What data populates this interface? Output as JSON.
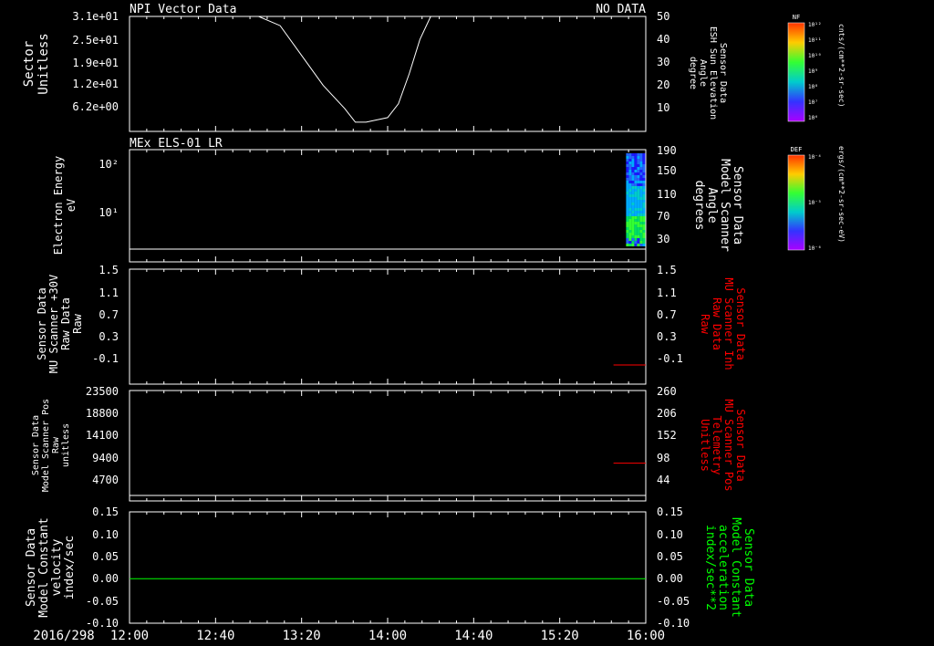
{
  "date_label": "2016/298",
  "time_ticks": [
    "12:00",
    "12:40",
    "13:20",
    "14:00",
    "14:40",
    "15:20",
    "16:00"
  ],
  "colors": {
    "white": "#ffffff",
    "red": "#ff0000",
    "green": "#00ff00"
  },
  "panels": [
    {
      "id": "npi",
      "title_left": "NPI Vector Data",
      "title_right": "NO DATA",
      "ylabel_left": [
        "Sector",
        "Unitless"
      ],
      "yticks_left": [
        "3.1e+01",
        "2.5e+01",
        "1.9e+01",
        "1.2e+01",
        "6.2e+00"
      ],
      "ylabel_right": [
        "Sensor Data",
        "ESH Sun Elevation",
        "Angle",
        "degree"
      ],
      "yticks_right": [
        "50",
        "40",
        "30",
        "20",
        "10"
      ],
      "colorbar": {
        "label": "NF",
        "units": "cnts/(cm**2-sr-sec)",
        "ticks": [
          "10¹²",
          "10¹¹",
          "10¹⁰",
          "10⁹",
          "10⁸",
          "10⁷",
          "10⁶"
        ]
      }
    },
    {
      "id": "els",
      "title_left": "MEx ELS-01 LR",
      "ylabel_left": [
        "Electron Energy",
        "eV"
      ],
      "yticks_left": [
        "10²",
        "10¹"
      ],
      "ylabel_right": [
        "Sensor Data",
        "Model Scanner",
        "Angle",
        "degrees"
      ],
      "yticks_right": [
        "190",
        "150",
        "110",
        "70",
        "30"
      ],
      "colorbar": {
        "label": "DEF",
        "units": "ergs/(cm**2-sr-sec-eV)",
        "ticks": [
          "10⁻⁴",
          "10⁻⁵",
          "10⁻⁶"
        ]
      }
    },
    {
      "id": "mu_raw",
      "ylabel_left": [
        "Sensor Data",
        "MU Scanner +30V",
        "Raw Data",
        "Raw"
      ],
      "yticks_left": [
        "1.5",
        "1.1",
        "0.7",
        "0.3",
        "-0.1"
      ],
      "ylabel_right": [
        "Sensor Data",
        "MU Scanner Inh",
        "Raw Data",
        "Raw"
      ],
      "yticks_right": [
        "1.5",
        "1.1",
        "0.7",
        "0.3",
        "-0.1"
      ]
    },
    {
      "id": "scanner_pos",
      "ylabel_left": [
        "Sensor Data",
        "Model Scanner Pos",
        "Raw",
        "unitless"
      ],
      "yticks_left": [
        "23500",
        "18800",
        "14100",
        "9400",
        "4700"
      ],
      "ylabel_right": [
        "Sensor Data",
        "MU Scanner Pos",
        "Telemetry",
        "Unitless"
      ],
      "yticks_right": [
        "260",
        "206",
        "152",
        "98",
        "44"
      ]
    },
    {
      "id": "velocity",
      "ylabel_left": [
        "Sensor Data",
        "Model Constant",
        "velocity",
        "index/sec"
      ],
      "yticks_left": [
        "0.15",
        "0.10",
        "0.05",
        "0.00",
        "-0.05",
        "-0.10"
      ],
      "ylabel_right": [
        "Sensor Data",
        "Model Constant",
        "acceleration",
        "index/sec**2"
      ],
      "yticks_right": [
        "0.15",
        "0.10",
        "0.05",
        "0.00",
        "-0.05",
        "-0.10"
      ]
    }
  ],
  "chart_data": [
    {
      "type": "line",
      "panel": "npi",
      "x_range": [
        "12:00",
        "16:00"
      ],
      "ylim": [
        0,
        50
      ],
      "x": [
        "12:00",
        "13:00",
        "13:10",
        "13:20",
        "13:30",
        "13:40",
        "13:45",
        "13:50",
        "13:55",
        "14:00",
        "14:05",
        "14:10",
        "14:15",
        "14:20",
        "16:00"
      ],
      "y": [
        50,
        50,
        46,
        33,
        20,
        10,
        4,
        4,
        5,
        6,
        12,
        25,
        40,
        50,
        50
      ]
    },
    {
      "type": "heatmap",
      "panel": "els",
      "x_range": [
        "15:50",
        "16:00"
      ],
      "y_range_energy_ev": [
        1.5,
        200
      ],
      "note_values": "spectrogram strip at end of interval",
      "baseline_energy_ev": 1.5
    },
    {
      "type": "line",
      "panel": "mu_raw",
      "axis": "right",
      "ylim": [
        -0.3,
        1.5
      ],
      "x": [
        "15:45",
        "16:00"
      ],
      "y": [
        0,
        0
      ]
    },
    {
      "type": "line",
      "panel": "scanner_pos",
      "axis": "right",
      "ylim": [
        0,
        260
      ],
      "x": [
        "15:45",
        "16:00"
      ],
      "y": [
        89,
        89
      ]
    },
    {
      "type": "line",
      "panel": "velocity",
      "ylim": [
        -0.1,
        0.15
      ],
      "x": [
        "12:00",
        "16:00"
      ],
      "y": [
        0.0,
        0.0
      ]
    }
  ]
}
